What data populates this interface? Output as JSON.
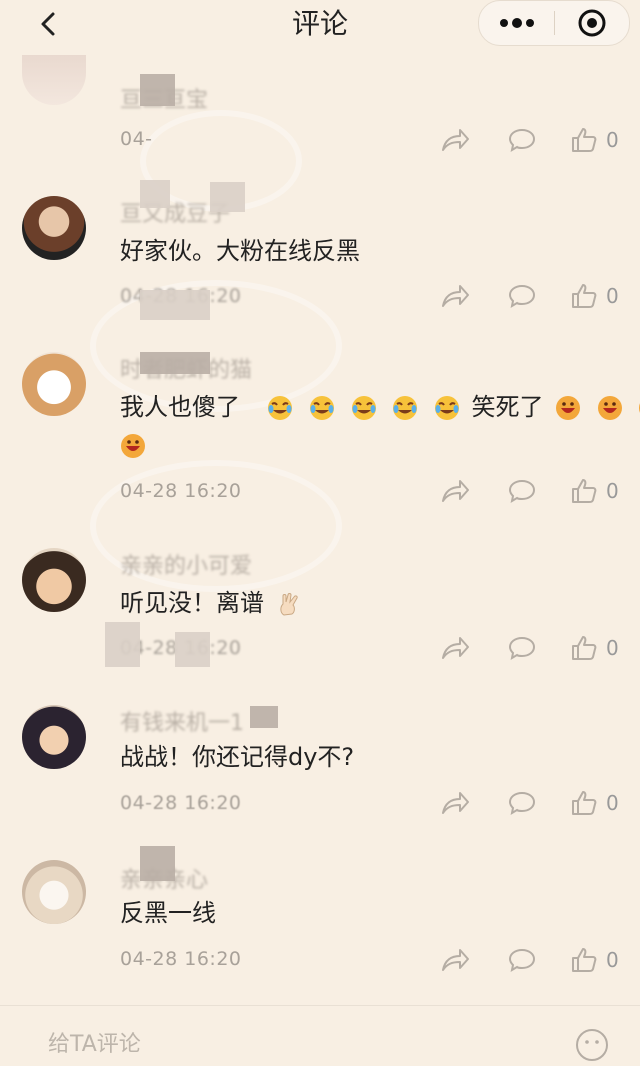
{
  "header": {
    "title": "评论"
  },
  "comments": [
    {
      "username": "亘三亘宝",
      "content": "",
      "time": "04-",
      "like_count": "0"
    },
    {
      "username": "亘又成豆子",
      "content": "好家伙。大粉在线反黑",
      "time": "04-28 16:20",
      "like_count": "0"
    },
    {
      "username": "时者肥虾的猫",
      "content_line1": "我人也傻了",
      "content_mid": "笑死了",
      "time": "04-28 16:20",
      "like_count": "0"
    },
    {
      "username": "亲亲的小可爱",
      "content": "听见没！离谱",
      "time": "04-28 16:20",
      "like_count": "0"
    },
    {
      "username": "有钱来机一1",
      "content": "战战！你还记得dy不?",
      "time": "04-28 16:20",
      "like_count": "0"
    },
    {
      "username": "亲亲亲心",
      "content": "反黑一线",
      "time": "04-28 16:20",
      "like_count": "0"
    }
  ],
  "footer": {
    "input_placeholder": "给TA评论"
  },
  "colors": {
    "background": "#f8efe3",
    "text": "#222222",
    "muted": "#a8a199",
    "icon": "#b5ada4"
  },
  "icons": {
    "back": "chevron-left-icon",
    "more": "more-dots-icon",
    "close": "target-close-icon",
    "share": "share-arrow-icon",
    "reply": "speech-bubble-icon",
    "like": "thumbs-up-icon",
    "emoji_laugh_cry": "laugh-cry-emoji",
    "emoji_grin": "grinning-emoji",
    "emoji_ok": "ok-hand-emoji"
  }
}
